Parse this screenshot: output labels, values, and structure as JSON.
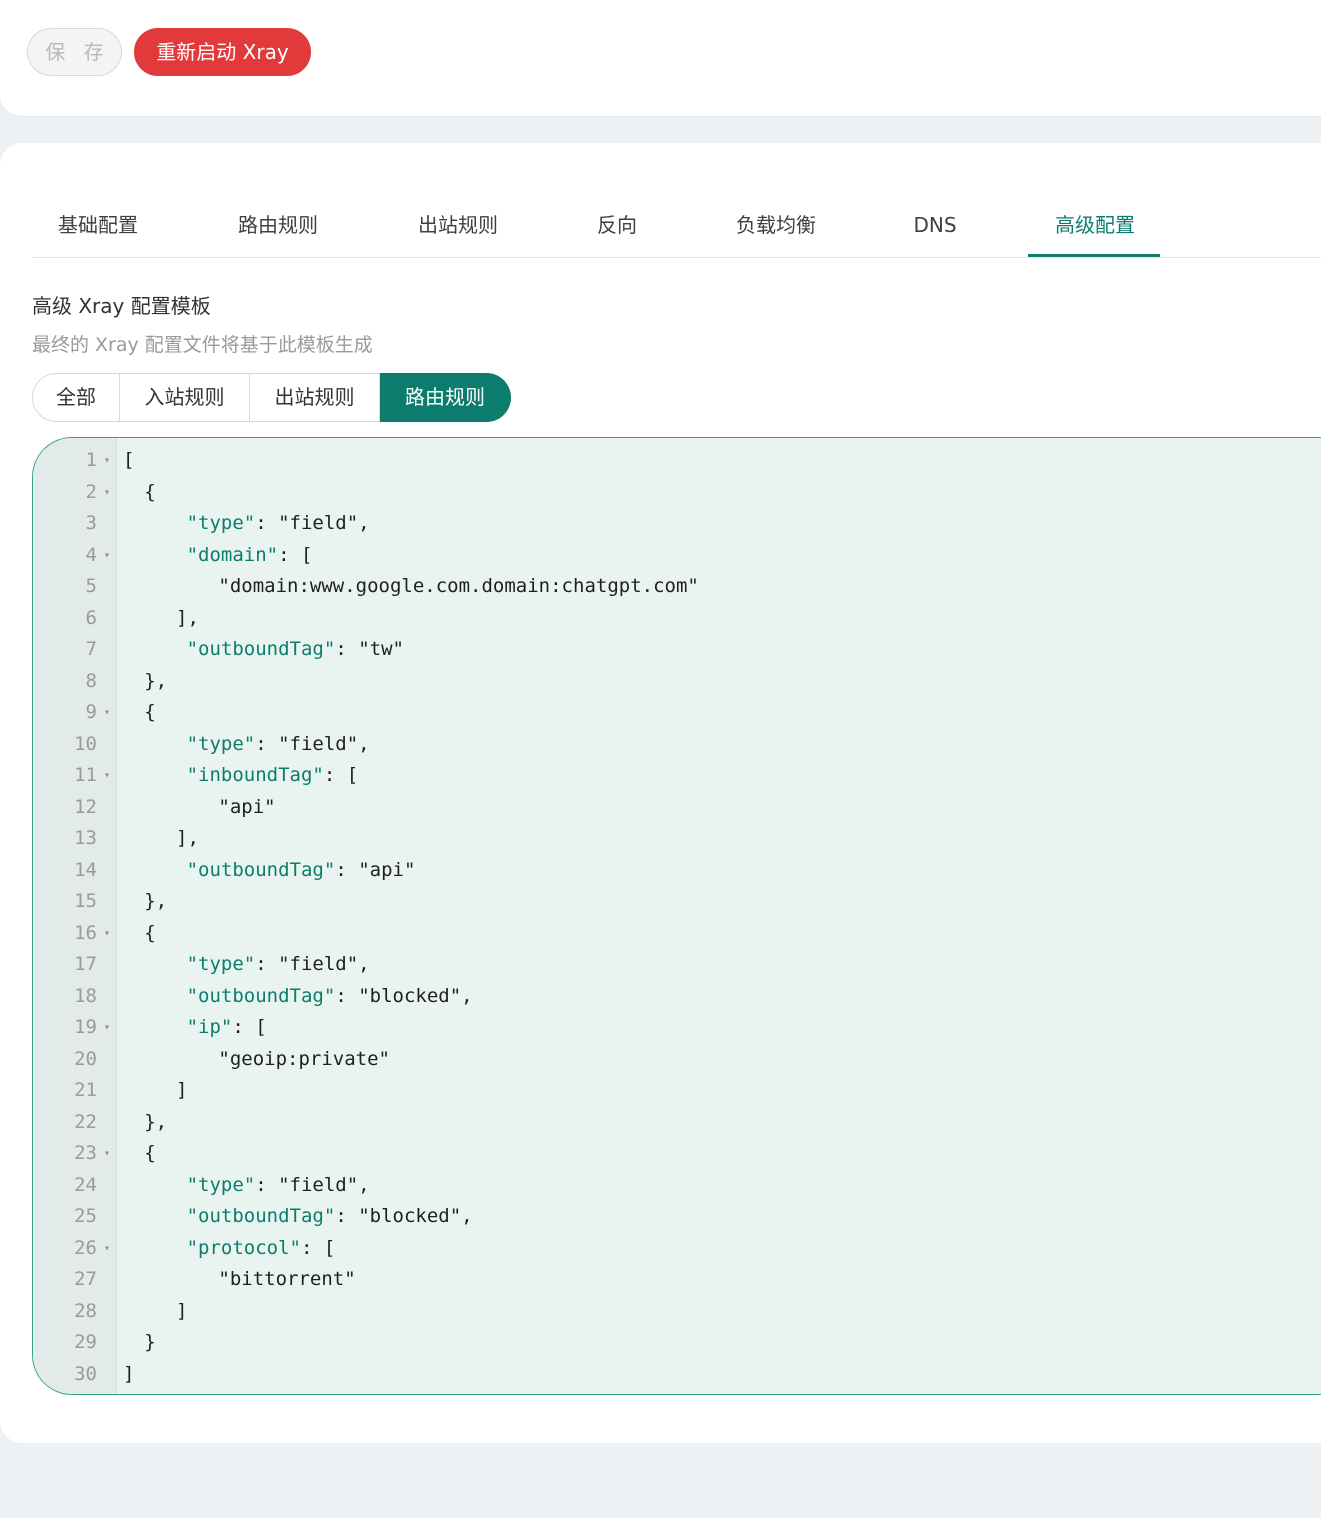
{
  "toolbar": {
    "save_label": "保 存",
    "restart_label": "重新启动 Xray"
  },
  "tabs": [
    {
      "label": "基础配置",
      "active": false
    },
    {
      "label": "路由规则",
      "active": false
    },
    {
      "label": "出站规则",
      "active": false
    },
    {
      "label": "反向",
      "active": false
    },
    {
      "label": "负载均衡",
      "active": false
    },
    {
      "label": "DNS",
      "active": false
    },
    {
      "label": "高级配置",
      "active": true
    }
  ],
  "section": {
    "title": "高级 Xray 配置模板",
    "description": "最终的 Xray 配置文件将基于此模板生成"
  },
  "segments": [
    {
      "label": "全部",
      "active": false
    },
    {
      "label": "入站规则",
      "active": false
    },
    {
      "label": "出站规则",
      "active": false
    },
    {
      "label": "路由规则",
      "active": true
    }
  ],
  "colors": {
    "accent": "#0c7d6c",
    "danger": "#e23a3a",
    "editor_bg": "#e9f4f1"
  },
  "editor": {
    "lines": [
      {
        "n": "1",
        "fold": true,
        "indent": 0,
        "parts": [
          {
            "t": "["
          }
        ]
      },
      {
        "n": "2",
        "fold": true,
        "indent": 2,
        "parts": [
          {
            "t": "{"
          }
        ]
      },
      {
        "n": "3",
        "fold": false,
        "indent": 6,
        "parts": [
          {
            "t": "\"type\"",
            "k": 1
          },
          {
            "t": ": \"field\","
          }
        ]
      },
      {
        "n": "4",
        "fold": true,
        "indent": 6,
        "parts": [
          {
            "t": "\"domain\"",
            "k": 1
          },
          {
            "t": ": ["
          }
        ]
      },
      {
        "n": "5",
        "fold": false,
        "indent": 9,
        "parts": [
          {
            "t": "\"domain:www.google.com.domain:chatgpt.com\""
          }
        ]
      },
      {
        "n": "6",
        "fold": false,
        "indent": 5,
        "parts": [
          {
            "t": "],"
          }
        ]
      },
      {
        "n": "7",
        "fold": false,
        "indent": 6,
        "parts": [
          {
            "t": "\"outboundTag\"",
            "k": 1
          },
          {
            "t": ": \"tw\""
          }
        ]
      },
      {
        "n": "8",
        "fold": false,
        "indent": 2,
        "parts": [
          {
            "t": "},"
          }
        ]
      },
      {
        "n": "9",
        "fold": true,
        "indent": 2,
        "parts": [
          {
            "t": "{"
          }
        ]
      },
      {
        "n": "10",
        "fold": false,
        "indent": 6,
        "parts": [
          {
            "t": "\"type\"",
            "k": 1
          },
          {
            "t": ": \"field\","
          }
        ]
      },
      {
        "n": "11",
        "fold": true,
        "indent": 6,
        "parts": [
          {
            "t": "\"inboundTag\"",
            "k": 1
          },
          {
            "t": ": ["
          }
        ]
      },
      {
        "n": "12",
        "fold": false,
        "indent": 9,
        "parts": [
          {
            "t": "\"api\""
          }
        ]
      },
      {
        "n": "13",
        "fold": false,
        "indent": 5,
        "parts": [
          {
            "t": "],"
          }
        ]
      },
      {
        "n": "14",
        "fold": false,
        "indent": 6,
        "parts": [
          {
            "t": "\"outboundTag\"",
            "k": 1
          },
          {
            "t": ": \"api\""
          }
        ]
      },
      {
        "n": "15",
        "fold": false,
        "indent": 2,
        "parts": [
          {
            "t": "},"
          }
        ]
      },
      {
        "n": "16",
        "fold": true,
        "indent": 2,
        "parts": [
          {
            "t": "{"
          }
        ]
      },
      {
        "n": "17",
        "fold": false,
        "indent": 6,
        "parts": [
          {
            "t": "\"type\"",
            "k": 1
          },
          {
            "t": ": \"field\","
          }
        ]
      },
      {
        "n": "18",
        "fold": false,
        "indent": 6,
        "parts": [
          {
            "t": "\"outboundTag\"",
            "k": 1
          },
          {
            "t": ": \"blocked\","
          }
        ]
      },
      {
        "n": "19",
        "fold": true,
        "indent": 6,
        "parts": [
          {
            "t": "\"ip\"",
            "k": 1
          },
          {
            "t": ": ["
          }
        ]
      },
      {
        "n": "20",
        "fold": false,
        "indent": 9,
        "parts": [
          {
            "t": "\"geoip:private\""
          }
        ]
      },
      {
        "n": "21",
        "fold": false,
        "indent": 5,
        "parts": [
          {
            "t": "]"
          }
        ]
      },
      {
        "n": "22",
        "fold": false,
        "indent": 2,
        "parts": [
          {
            "t": "},"
          }
        ]
      },
      {
        "n": "23",
        "fold": true,
        "indent": 2,
        "parts": [
          {
            "t": "{"
          }
        ]
      },
      {
        "n": "24",
        "fold": false,
        "indent": 6,
        "parts": [
          {
            "t": "\"type\"",
            "k": 1
          },
          {
            "t": ": \"field\","
          }
        ]
      },
      {
        "n": "25",
        "fold": false,
        "indent": 6,
        "parts": [
          {
            "t": "\"outboundTag\"",
            "k": 1
          },
          {
            "t": ": \"blocked\","
          }
        ]
      },
      {
        "n": "26",
        "fold": true,
        "indent": 6,
        "parts": [
          {
            "t": "\"protocol\"",
            "k": 1
          },
          {
            "t": ": ["
          }
        ]
      },
      {
        "n": "27",
        "fold": false,
        "indent": 9,
        "parts": [
          {
            "t": "\"bittorrent\""
          }
        ]
      },
      {
        "n": "28",
        "fold": false,
        "indent": 5,
        "parts": [
          {
            "t": "]"
          }
        ]
      },
      {
        "n": "29",
        "fold": false,
        "indent": 2,
        "parts": [
          {
            "t": "}"
          }
        ]
      },
      {
        "n": "30",
        "fold": false,
        "indent": 0,
        "parts": [
          {
            "t": "]"
          }
        ]
      }
    ]
  }
}
